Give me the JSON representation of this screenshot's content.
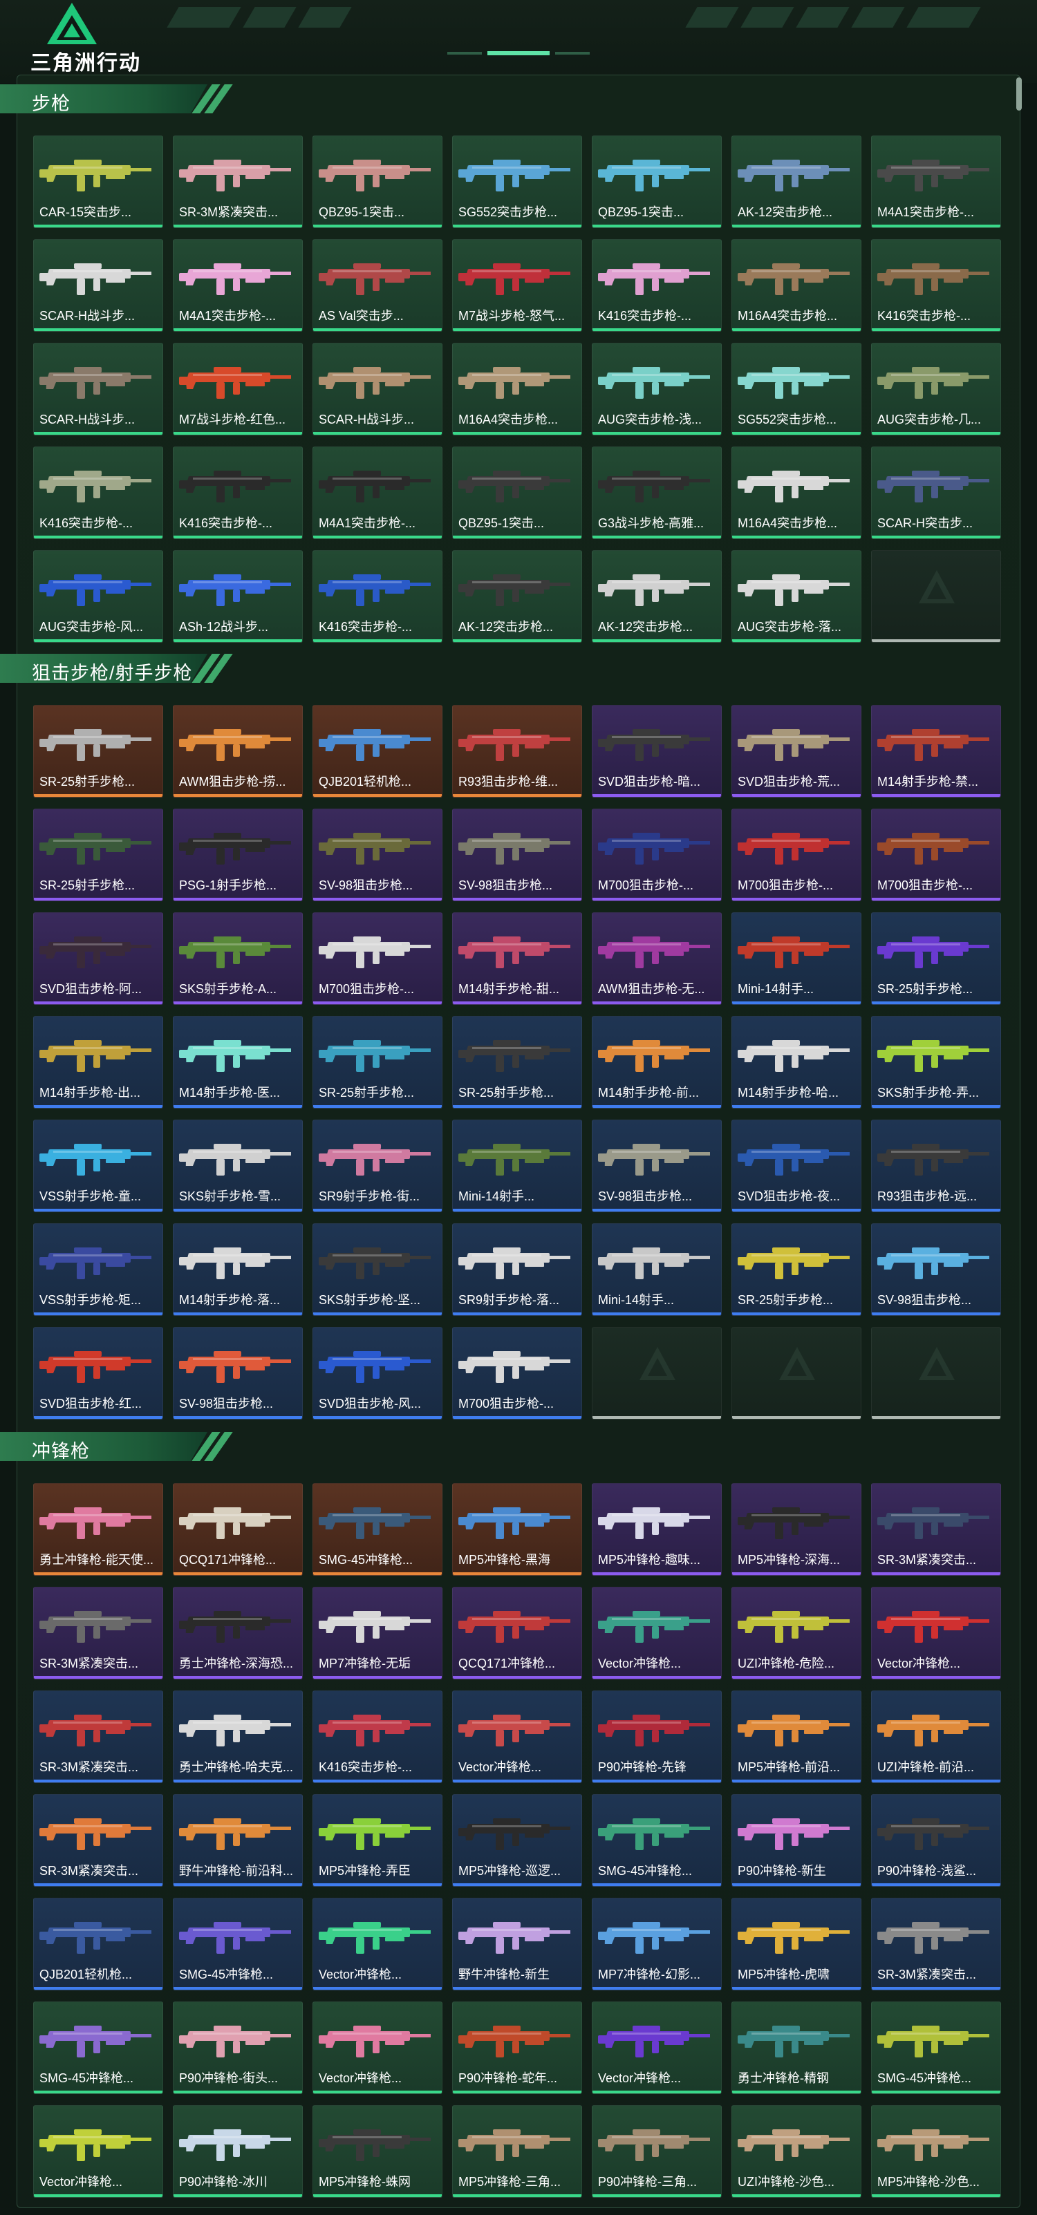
{
  "app": {
    "logo_text": "三角洲行动",
    "logo": "delta-force-logo"
  },
  "colors": {
    "green": "#39d98a",
    "blue": "#3f7df0",
    "purple": "#8c5cf0",
    "orange": "#e8873a",
    "empty": "#aeb8b2",
    "header": "#2e7c4f"
  },
  "sections": [
    {
      "id": "rifles",
      "title": "步枪",
      "items": [
        {
          "label": "CAR-15突击步...",
          "rarity": "green",
          "tint": "#b8c24a"
        },
        {
          "label": "SR-3M紧凑突击...",
          "rarity": "green",
          "tint": "#d9a0a8"
        },
        {
          "label": "QBZ95-1突击...",
          "rarity": "green",
          "tint": "#c98f8a"
        },
        {
          "label": "SG552突击步枪...",
          "rarity": "green",
          "tint": "#5aa6d6"
        },
        {
          "label": "QBZ95-1突击...",
          "rarity": "green",
          "tint": "#5ab6d6"
        },
        {
          "label": "AK-12突击步枪...",
          "rarity": "green",
          "tint": "#6c8fb8"
        },
        {
          "label": "M4A1突击步枪-...",
          "rarity": "green",
          "tint": "#4a4a4a"
        },
        {
          "label": "SCAR-H战斗步...",
          "rarity": "green",
          "tint": "#d8d8d8"
        },
        {
          "label": "M4A1突击步枪-...",
          "rarity": "green",
          "tint": "#e8a6d6"
        },
        {
          "label": "AS Val突击步...",
          "rarity": "green",
          "tint": "#b04848"
        },
        {
          "label": "M7战斗步枪-怒气...",
          "rarity": "green",
          "tint": "#c0303a"
        },
        {
          "label": "K416突击步枪-...",
          "rarity": "green",
          "tint": "#e0a0d0"
        },
        {
          "label": "M16A4突击步枪...",
          "rarity": "green",
          "tint": "#9a7a5a"
        },
        {
          "label": "K416突击步枪-...",
          "rarity": "green",
          "tint": "#8a6a4a"
        },
        {
          "label": "SCAR-H战斗步...",
          "rarity": "green",
          "tint": "#8a7a6a"
        },
        {
          "label": "M7战斗步枪-红色...",
          "rarity": "green",
          "tint": "#d84a2a"
        },
        {
          "label": "SCAR-H战斗步...",
          "rarity": "green",
          "tint": "#b09070"
        },
        {
          "label": "M16A4突击步枪...",
          "rarity": "green",
          "tint": "#b09878"
        },
        {
          "label": "AUG突击步枪-浅...",
          "rarity": "green",
          "tint": "#7ad0c8"
        },
        {
          "label": "SG552突击步枪...",
          "rarity": "green",
          "tint": "#86d6ce"
        },
        {
          "label": "AUG突击步枪-几...",
          "rarity": "green",
          "tint": "#8a9a6a"
        },
        {
          "label": "K416突击步枪-...",
          "rarity": "green",
          "tint": "#a0a88a"
        },
        {
          "label": "K416突击步枪-...",
          "rarity": "green",
          "tint": "#2a2a2a"
        },
        {
          "label": "M4A1突击步枪-...",
          "rarity": "green",
          "tint": "#2a2a2a"
        },
        {
          "label": "QBZ95-1突击...",
          "rarity": "green",
          "tint": "#3a3a3a"
        },
        {
          "label": "G3战斗步枪-高雅...",
          "rarity": "green",
          "tint": "#2e2e2e"
        },
        {
          "label": "M16A4突击步枪...",
          "rarity": "green",
          "tint": "#d8d8d8"
        },
        {
          "label": "SCAR-H突击步...",
          "rarity": "green",
          "tint": "#4a5a8a"
        },
        {
          "label": "AUG突击步枪-风...",
          "rarity": "green",
          "tint": "#2a5ad0"
        },
        {
          "label": "ASh-12战斗步...",
          "rarity": "green",
          "tint": "#3a6ae0"
        },
        {
          "label": "K416突击步枪-...",
          "rarity": "green",
          "tint": "#2a5ac8"
        },
        {
          "label": "AK-12突击步枪...",
          "rarity": "green",
          "tint": "#3a3a3a"
        },
        {
          "label": "AK-12突击步枪...",
          "rarity": "green",
          "tint": "#d0d0d0"
        },
        {
          "label": "AUG突击步枪-落...",
          "rarity": "green",
          "tint": "#d8d8d8"
        },
        {
          "label": "",
          "rarity": "empty",
          "tint": ""
        }
      ]
    },
    {
      "id": "snipers",
      "title": "狙击步枪/射手步枪",
      "items": [
        {
          "label": "SR-25射手步枪...",
          "rarity": "orange",
          "tint": "#b0b0b0"
        },
        {
          "label": "AWM狙击步枪-捞...",
          "rarity": "orange",
          "tint": "#e08a3a"
        },
        {
          "label": "QJB201轻机枪...",
          "rarity": "orange",
          "tint": "#4a8ad0"
        },
        {
          "label": "R93狙击步枪-维...",
          "rarity": "orange",
          "tint": "#c04040"
        },
        {
          "label": "SVD狙击步枪-暗...",
          "rarity": "purple",
          "tint": "#3a3a3a"
        },
        {
          "label": "SVD狙击步枪-荒...",
          "rarity": "purple",
          "tint": "#a8987a"
        },
        {
          "label": "M14射手步枪-禁...",
          "rarity": "purple",
          "tint": "#b04030"
        },
        {
          "label": "SR-25射手步枪...",
          "rarity": "purple",
          "tint": "#3a5a3a"
        },
        {
          "label": "PSG-1射手步枪...",
          "rarity": "purple",
          "tint": "#2a2a2a"
        },
        {
          "label": "SV-98狙击步枪...",
          "rarity": "purple",
          "tint": "#6a6a3a"
        },
        {
          "label": "SV-98狙击步枪...",
          "rarity": "purple",
          "tint": "#7a7a6a"
        },
        {
          "label": "M700狙击步枪-...",
          "rarity": "purple",
          "tint": "#2a3a8a"
        },
        {
          "label": "M700狙击步枪-...",
          "rarity": "purple",
          "tint": "#c03030"
        },
        {
          "label": "M700狙击步枪-...",
          "rarity": "purple",
          "tint": "#9a4a2a"
        },
        {
          "label": "SVD狙击步枪-阿...",
          "rarity": "purple",
          "tint": "#3a2a3a"
        },
        {
          "label": "SKS射手步枪-A...",
          "rarity": "purple",
          "tint": "#5a8a3a"
        },
        {
          "label": "M700狙击步枪-...",
          "rarity": "purple",
          "tint": "#d8d8d8"
        },
        {
          "label": "M14射手步枪-甜...",
          "rarity": "purple",
          "tint": "#c04a6a"
        },
        {
          "label": "AWM狙击步枪-无...",
          "rarity": "purple",
          "tint": "#a03aa0"
        },
        {
          "label": "Mini-14射手...",
          "rarity": "blue",
          "tint": "#c03a2a"
        },
        {
          "label": "SR-25射手步枪...",
          "rarity": "blue",
          "tint": "#6a3ad0"
        },
        {
          "label": "M14射手步枪-出...",
          "rarity": "blue",
          "tint": "#c0a03a"
        },
        {
          "label": "M14射手步枪-医...",
          "rarity": "blue",
          "tint": "#7ae0d0"
        },
        {
          "label": "SR-25射手步枪...",
          "rarity": "blue",
          "tint": "#3aa0c0"
        },
        {
          "label": "SR-25射手步枪...",
          "rarity": "blue",
          "tint": "#3a3a3a"
        },
        {
          "label": "M14射手步枪-前...",
          "rarity": "blue",
          "tint": "#e08a3a"
        },
        {
          "label": "M14射手步枪-哈...",
          "rarity": "blue",
          "tint": "#d8d8d8"
        },
        {
          "label": "SKS射手步枪-弄...",
          "rarity": "blue",
          "tint": "#a0d03a"
        },
        {
          "label": "VSS射手步枪-童...",
          "rarity": "blue",
          "tint": "#3ab0e0"
        },
        {
          "label": "SKS射手步枪-雪...",
          "rarity": "blue",
          "tint": "#d0d0d0"
        },
        {
          "label": "SR9射手步枪-街...",
          "rarity": "blue",
          "tint": "#d07aa0"
        },
        {
          "label": "Mini-14射手...",
          "rarity": "blue",
          "tint": "#5a7a3a"
        },
        {
          "label": "SV-98狙击步枪...",
          "rarity": "blue",
          "tint": "#9a9a8a"
        },
        {
          "label": "SVD狙击步枪-夜...",
          "rarity": "blue",
          "tint": "#2a5ab0"
        },
        {
          "label": "R93狙击步枪-远...",
          "rarity": "blue",
          "tint": "#3a3a3a"
        },
        {
          "label": "VSS射手步枪-矩...",
          "rarity": "blue",
          "tint": "#3a4aa0"
        },
        {
          "label": "M14射手步枪-落...",
          "rarity": "blue",
          "tint": "#d8d8d8"
        },
        {
          "label": "SKS射手步枪-坚...",
          "rarity": "blue",
          "tint": "#3a3a3a"
        },
        {
          "label": "SR9射手步枪-落...",
          "rarity": "blue",
          "tint": "#d8d8d8"
        },
        {
          "label": "Mini-14射手...",
          "rarity": "blue",
          "tint": "#c8c8c8"
        },
        {
          "label": "SR-25射手步枪...",
          "rarity": "blue",
          "tint": "#d0c03a"
        },
        {
          "label": "SV-98狙击步枪...",
          "rarity": "blue",
          "tint": "#5ab0e0"
        },
        {
          "label": "SVD狙击步枪-红...",
          "rarity": "blue",
          "tint": "#d03a2a"
        },
        {
          "label": "SV-98狙击步枪...",
          "rarity": "blue",
          "tint": "#e05a3a"
        },
        {
          "label": "SVD狙击步枪-风...",
          "rarity": "blue",
          "tint": "#2a5ad0"
        },
        {
          "label": "M700狙击步枪-...",
          "rarity": "blue",
          "tint": "#d8d8d8"
        },
        {
          "label": "",
          "rarity": "empty",
          "tint": ""
        },
        {
          "label": "",
          "rarity": "empty",
          "tint": ""
        },
        {
          "label": "",
          "rarity": "empty",
          "tint": ""
        }
      ]
    },
    {
      "id": "smgs",
      "title": "冲锋枪",
      "items": [
        {
          "label": "勇士冲锋枪-能天使...",
          "rarity": "orange",
          "tint": "#e07aa0"
        },
        {
          "label": "QCQ171冲锋枪...",
          "rarity": "orange",
          "tint": "#d8d0c0"
        },
        {
          "label": "SMG-45冲锋枪...",
          "rarity": "orange",
          "tint": "#3a5a7a"
        },
        {
          "label": "MP5冲锋枪-黑海",
          "rarity": "orange",
          "tint": "#4a8ad0"
        },
        {
          "label": "MP5冲锋枪-趣味...",
          "rarity": "purple",
          "tint": "#d8d8e8"
        },
        {
          "label": "MP5冲锋枪-深海...",
          "rarity": "purple",
          "tint": "#2a2a2a"
        },
        {
          "label": "SR-3M紧凑突击...",
          "rarity": "purple",
          "tint": "#3a4a6a"
        },
        {
          "label": "SR-3M紧凑突击...",
          "rarity": "purple",
          "tint": "#6a6a6a"
        },
        {
          "label": "勇士冲锋枪-深海恐...",
          "rarity": "purple",
          "tint": "#2a2a2a"
        },
        {
          "label": "MP7冲锋枪-无垢",
          "rarity": "purple",
          "tint": "#d8d8d8"
        },
        {
          "label": "QCQ171冲锋枪...",
          "rarity": "purple",
          "tint": "#c03a3a"
        },
        {
          "label": "Vector冲锋枪...",
          "rarity": "purple",
          "tint": "#3aa08a"
        },
        {
          "label": "UZI冲锋枪-危险...",
          "rarity": "purple",
          "tint": "#c0c03a"
        },
        {
          "label": "Vector冲锋枪...",
          "rarity": "purple",
          "tint": "#d03030"
        },
        {
          "label": "SR-3M紧凑突击...",
          "rarity": "blue",
          "tint": "#c03a3a"
        },
        {
          "label": "勇士冲锋枪-哈夫克...",
          "rarity": "blue",
          "tint": "#d8d8d8"
        },
        {
          "label": "K416突击步枪-...",
          "rarity": "blue",
          "tint": "#c03a4a"
        },
        {
          "label": "Vector冲锋枪...",
          "rarity": "blue",
          "tint": "#c84a4a"
        },
        {
          "label": "P90冲锋枪-先锋",
          "rarity": "blue",
          "tint": "#b02a3a"
        },
        {
          "label": "MP5冲锋枪-前沿...",
          "rarity": "blue",
          "tint": "#e08a3a"
        },
        {
          "label": "UZI冲锋枪-前沿...",
          "rarity": "blue",
          "tint": "#e08a3a"
        },
        {
          "label": "SR-3M紧凑突击...",
          "rarity": "blue",
          "tint": "#e07a3a"
        },
        {
          "label": "野牛冲锋枪-前沿科...",
          "rarity": "blue",
          "tint": "#e08a3a"
        },
        {
          "label": "MP5冲锋枪-弄臣",
          "rarity": "blue",
          "tint": "#8ad03a"
        },
        {
          "label": "MP5冲锋枪-巡逻...",
          "rarity": "blue",
          "tint": "#2a2a2a"
        },
        {
          "label": "SMG-45冲锋枪...",
          "rarity": "blue",
          "tint": "#3aa07a"
        },
        {
          "label": "P90冲锋枪-新生",
          "rarity": "blue",
          "tint": "#d07ad0"
        },
        {
          "label": "P90冲锋枪-浅鲨...",
          "rarity": "blue",
          "tint": "#3a3a3a"
        },
        {
          "label": "QJB201轻机枪...",
          "rarity": "blue",
          "tint": "#3a5aa0"
        },
        {
          "label": "SMG-45冲锋枪...",
          "rarity": "blue",
          "tint": "#6a5ad0"
        },
        {
          "label": "Vector冲锋枪...",
          "rarity": "blue",
          "tint": "#3ad08a"
        },
        {
          "label": "野牛冲锋枪-新生",
          "rarity": "blue",
          "tint": "#c0a0e0"
        },
        {
          "label": "MP7冲锋枪-幻影...",
          "rarity": "blue",
          "tint": "#5aa0e0"
        },
        {
          "label": "MP5冲锋枪-虎啸",
          "rarity": "blue",
          "tint": "#e0b03a"
        },
        {
          "label": "SR-3M紧凑突击...",
          "rarity": "blue",
          "tint": "#8a8a8a"
        },
        {
          "label": "SMG-45冲锋枪...",
          "rarity": "green",
          "tint": "#8a6ad0"
        },
        {
          "label": "P90冲锋枪-街头...",
          "rarity": "green",
          "tint": "#e0a0b0"
        },
        {
          "label": "Vector冲锋枪...",
          "rarity": "green",
          "tint": "#e07aa0"
        },
        {
          "label": "P90冲锋枪-蛇年...",
          "rarity": "green",
          "tint": "#c04a2a"
        },
        {
          "label": "Vector冲锋枪...",
          "rarity": "green",
          "tint": "#6a3ad0"
        },
        {
          "label": "勇士冲锋枪-精钢",
          "rarity": "green",
          "tint": "#3a8a8a"
        },
        {
          "label": "SMG-45冲锋枪...",
          "rarity": "green",
          "tint": "#b0c03a"
        },
        {
          "label": "Vector冲锋枪...",
          "rarity": "green",
          "tint": "#c0d03a"
        },
        {
          "label": "P90冲锋枪-冰川",
          "rarity": "green",
          "tint": "#c8d8e8"
        },
        {
          "label": "MP5冲锋枪-蛛网",
          "rarity": "green",
          "tint": "#3a3a3a"
        },
        {
          "label": "MP5冲锋枪-三角...",
          "rarity": "green",
          "tint": "#b09070"
        },
        {
          "label": "P90冲锋枪-三角...",
          "rarity": "green",
          "tint": "#a08a70"
        },
        {
          "label": "UZI冲锋枪-沙色...",
          "rarity": "green",
          "tint": "#c0a080"
        },
        {
          "label": "MP5冲锋枪-沙色...",
          "rarity": "green",
          "tint": "#b89a78"
        }
      ]
    }
  ]
}
